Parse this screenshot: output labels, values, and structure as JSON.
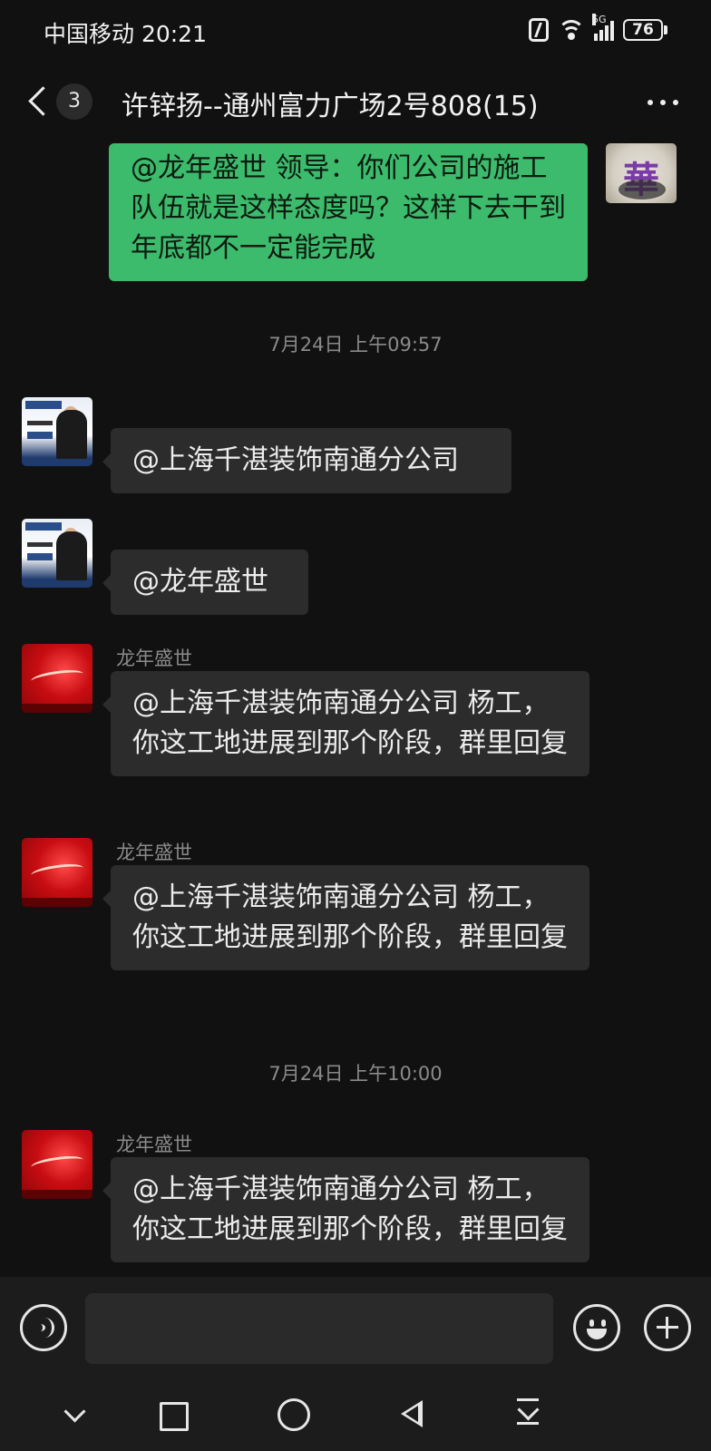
{
  "status_bar": {
    "carrier_time": "中国移动 20:21",
    "network": "5G",
    "battery": "76"
  },
  "header": {
    "unread_count": "3",
    "title": "许锌扬--通州富力广场2号808(15)"
  },
  "messages": {
    "m1": {
      "text": "@龙年盛世  领导：你们公司的施工队伍就是这样态度吗？这样下去干到年底都不一定能完成",
      "avatar": "華"
    },
    "t1": "7月24日 上午09:57",
    "m2": {
      "text": "@上海千湛装饰南通分公司"
    },
    "m3": {
      "text": "@龙年盛世"
    },
    "m4": {
      "sender": "龙年盛世",
      "text": "@上海千湛装饰南通分公司  杨工，你这工地进展到那个阶段，群里回复"
    },
    "m5": {
      "sender": "龙年盛世",
      "text": "@上海千湛装饰南通分公司  杨工，你这工地进展到那个阶段，群里回复"
    },
    "t2": "7月24日 上午10:00",
    "m6": {
      "sender": "龙年盛世",
      "text": "@上海千湛装饰南通分公司  杨工，你这工地进展到那个阶段，群里回复"
    }
  },
  "input": {
    "placeholder": ""
  },
  "colors": {
    "outgoing_bubble": "#3dbb6c",
    "incoming_bubble": "#2c2c2c",
    "background": "#111111"
  }
}
